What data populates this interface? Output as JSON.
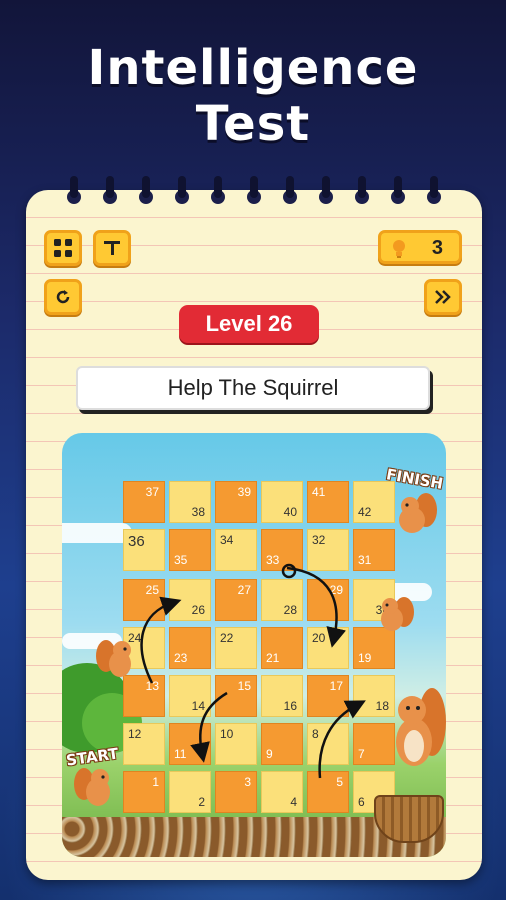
{
  "title_line1": "Intelligence",
  "title_line2": "Test",
  "toolbar": {
    "menu_icon": "grid-menu-icon",
    "tool_icon": "paint-roller-icon",
    "restart_icon": "restart-icon",
    "skip_icon": "skip-forward-icon",
    "hint_icon": "lightbulb-icon",
    "hint_count": "3"
  },
  "level_label": "Level 26",
  "instruction": "Help The Squirrel",
  "board": {
    "start_label": "START",
    "finish_label": "FINISH",
    "tiles": [
      "1",
      "2",
      "3",
      "4",
      "5",
      "6",
      "7",
      "8",
      "9",
      "10",
      "11",
      "12",
      "13",
      "14",
      "15",
      "16",
      "17",
      "18",
      "19",
      "20",
      "21",
      "22",
      "23",
      "24",
      "25",
      "26",
      "27",
      "28",
      "29",
      "30",
      "31",
      "32",
      "33",
      "34",
      "35",
      "36",
      "37",
      "38",
      "39",
      "40",
      "41",
      "42"
    ]
  },
  "colors": {
    "accent_orange": "#f59a31",
    "accent_yellow": "#fbe07a",
    "level_red": "#e22b35",
    "button_yellow": "#ffc933"
  }
}
